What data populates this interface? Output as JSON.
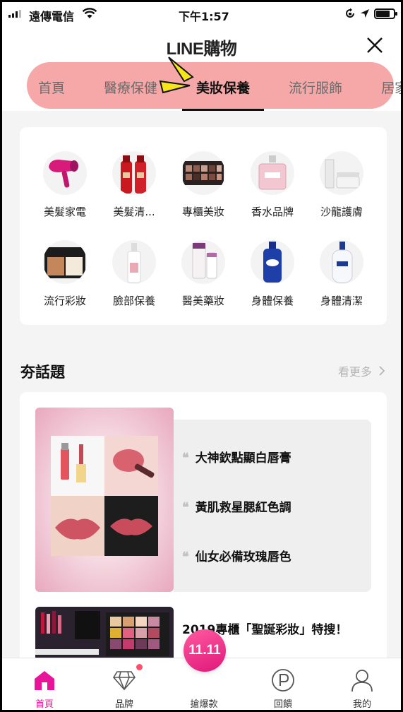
{
  "status_bar": {
    "carrier": "遠傳電信",
    "time": "下午1:57"
  },
  "header": {
    "logo": "LINE購物",
    "tabs": [
      {
        "label": "首頁"
      },
      {
        "label": "醫療保健"
      },
      {
        "label": "美妝保養",
        "active": true
      },
      {
        "label": "流行服飾"
      },
      {
        "label": "居家"
      }
    ]
  },
  "categories": [
    {
      "label": "美髮家電",
      "icon": "hair-dryer-icon"
    },
    {
      "label": "美髮清...",
      "icon": "shampoo-bottles-icon"
    },
    {
      "label": "專櫃美妝",
      "icon": "eyeshadow-palette-icon"
    },
    {
      "label": "香水品牌",
      "icon": "perfume-bottle-icon"
    },
    {
      "label": "沙龍護膚",
      "icon": "skincare-jar-icon"
    },
    {
      "label": "流行彩妝",
      "icon": "compact-powder-icon"
    },
    {
      "label": "臉部保養",
      "icon": "lotion-bottle-icon"
    },
    {
      "label": "醫美藥妝",
      "icon": "cream-tubes-icon"
    },
    {
      "label": "身體保養",
      "icon": "body-lotion-icon"
    },
    {
      "label": "身體清潔",
      "icon": "body-wash-icon"
    }
  ],
  "topic_section": {
    "title": "夯話題",
    "more_label": "看更多",
    "quotes": [
      {
        "text": "大神欽點顯白唇膏"
      },
      {
        "text": "黃肌救星腮紅色調"
      },
      {
        "text": "仙女必備玫瑰唇色"
      }
    ],
    "second_item_title": "2019專櫃「聖誕彩妝」特搜！"
  },
  "bottom_nav": {
    "items": [
      {
        "label": "首頁",
        "icon": "home-icon",
        "active": true
      },
      {
        "label": "品牌",
        "icon": "diamond-icon"
      },
      {
        "label": "搶爆款",
        "icon": "promo-1111-icon"
      },
      {
        "label": "回饋",
        "icon": "points-icon"
      },
      {
        "label": "我的",
        "icon": "profile-icon"
      }
    ],
    "promo_text": "11.11"
  },
  "colors": {
    "accent": "#e8159a",
    "tab_pill": "#f6a7a7",
    "badge": "#ff4f6a"
  }
}
